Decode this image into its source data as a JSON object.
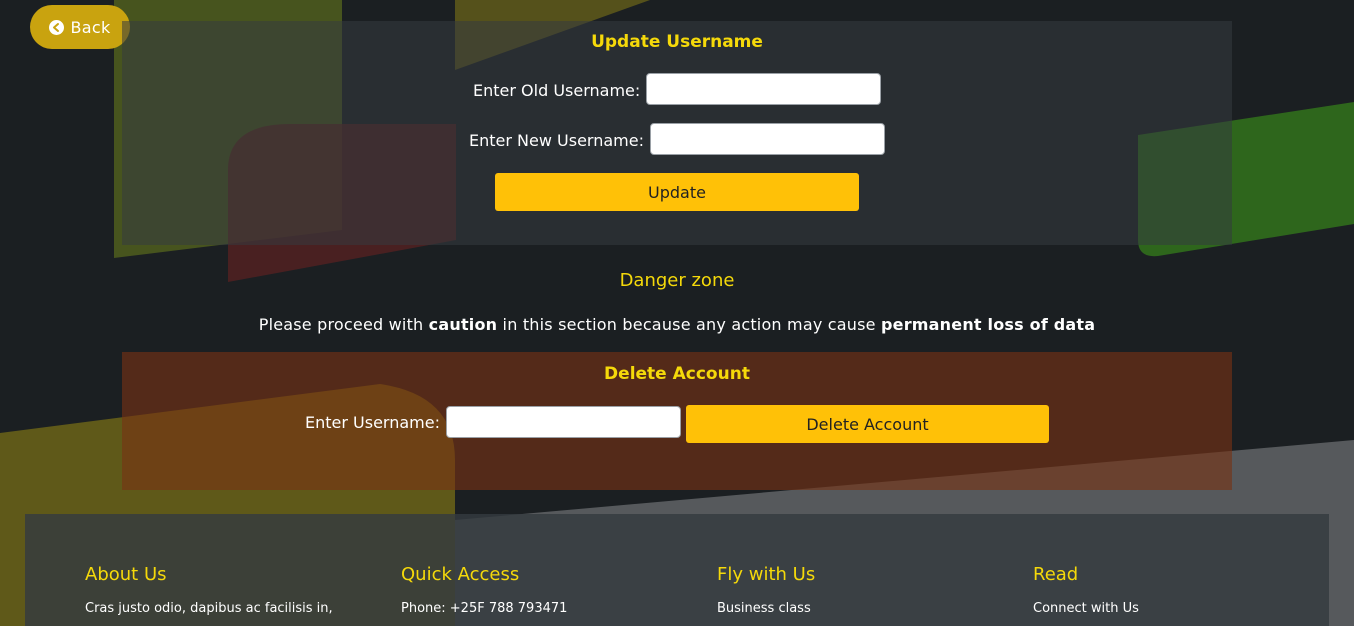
{
  "nav": {
    "back_label": "Back"
  },
  "update": {
    "title": "Update Username",
    "old_label": "Enter Old Username:",
    "old_value": "",
    "new_label": "Enter New Username:",
    "new_value": "",
    "button_label": "Update"
  },
  "danger": {
    "title": "Danger zone",
    "warning_prefix": "Please proceed with ",
    "warning_caution": "caution",
    "warning_middle": " in this section because any action may cause ",
    "warning_loss": "permanent loss of data"
  },
  "delete": {
    "title": "Delete Account",
    "username_label": "Enter Username:",
    "username_value": "",
    "button_label": "Delete Account"
  },
  "footer": {
    "columns": [
      {
        "heading": "About Us",
        "text": "Cras justo odio, dapibus ac facilisis in,"
      },
      {
        "heading": "Quick Access",
        "text": "Phone: +25F 788 793471"
      },
      {
        "heading": "Fly with Us",
        "text": "Business class"
      },
      {
        "heading": "Read",
        "text": "Connect with Us"
      }
    ]
  },
  "colors": {
    "accent_yellow": "#f5d90a",
    "button_yellow": "#ffc107",
    "back_button": "#c9a30f",
    "background": "#1b1f22",
    "danger_panel": "#5a3020"
  },
  "icons": {
    "back": "arrow-circle-left-icon"
  }
}
